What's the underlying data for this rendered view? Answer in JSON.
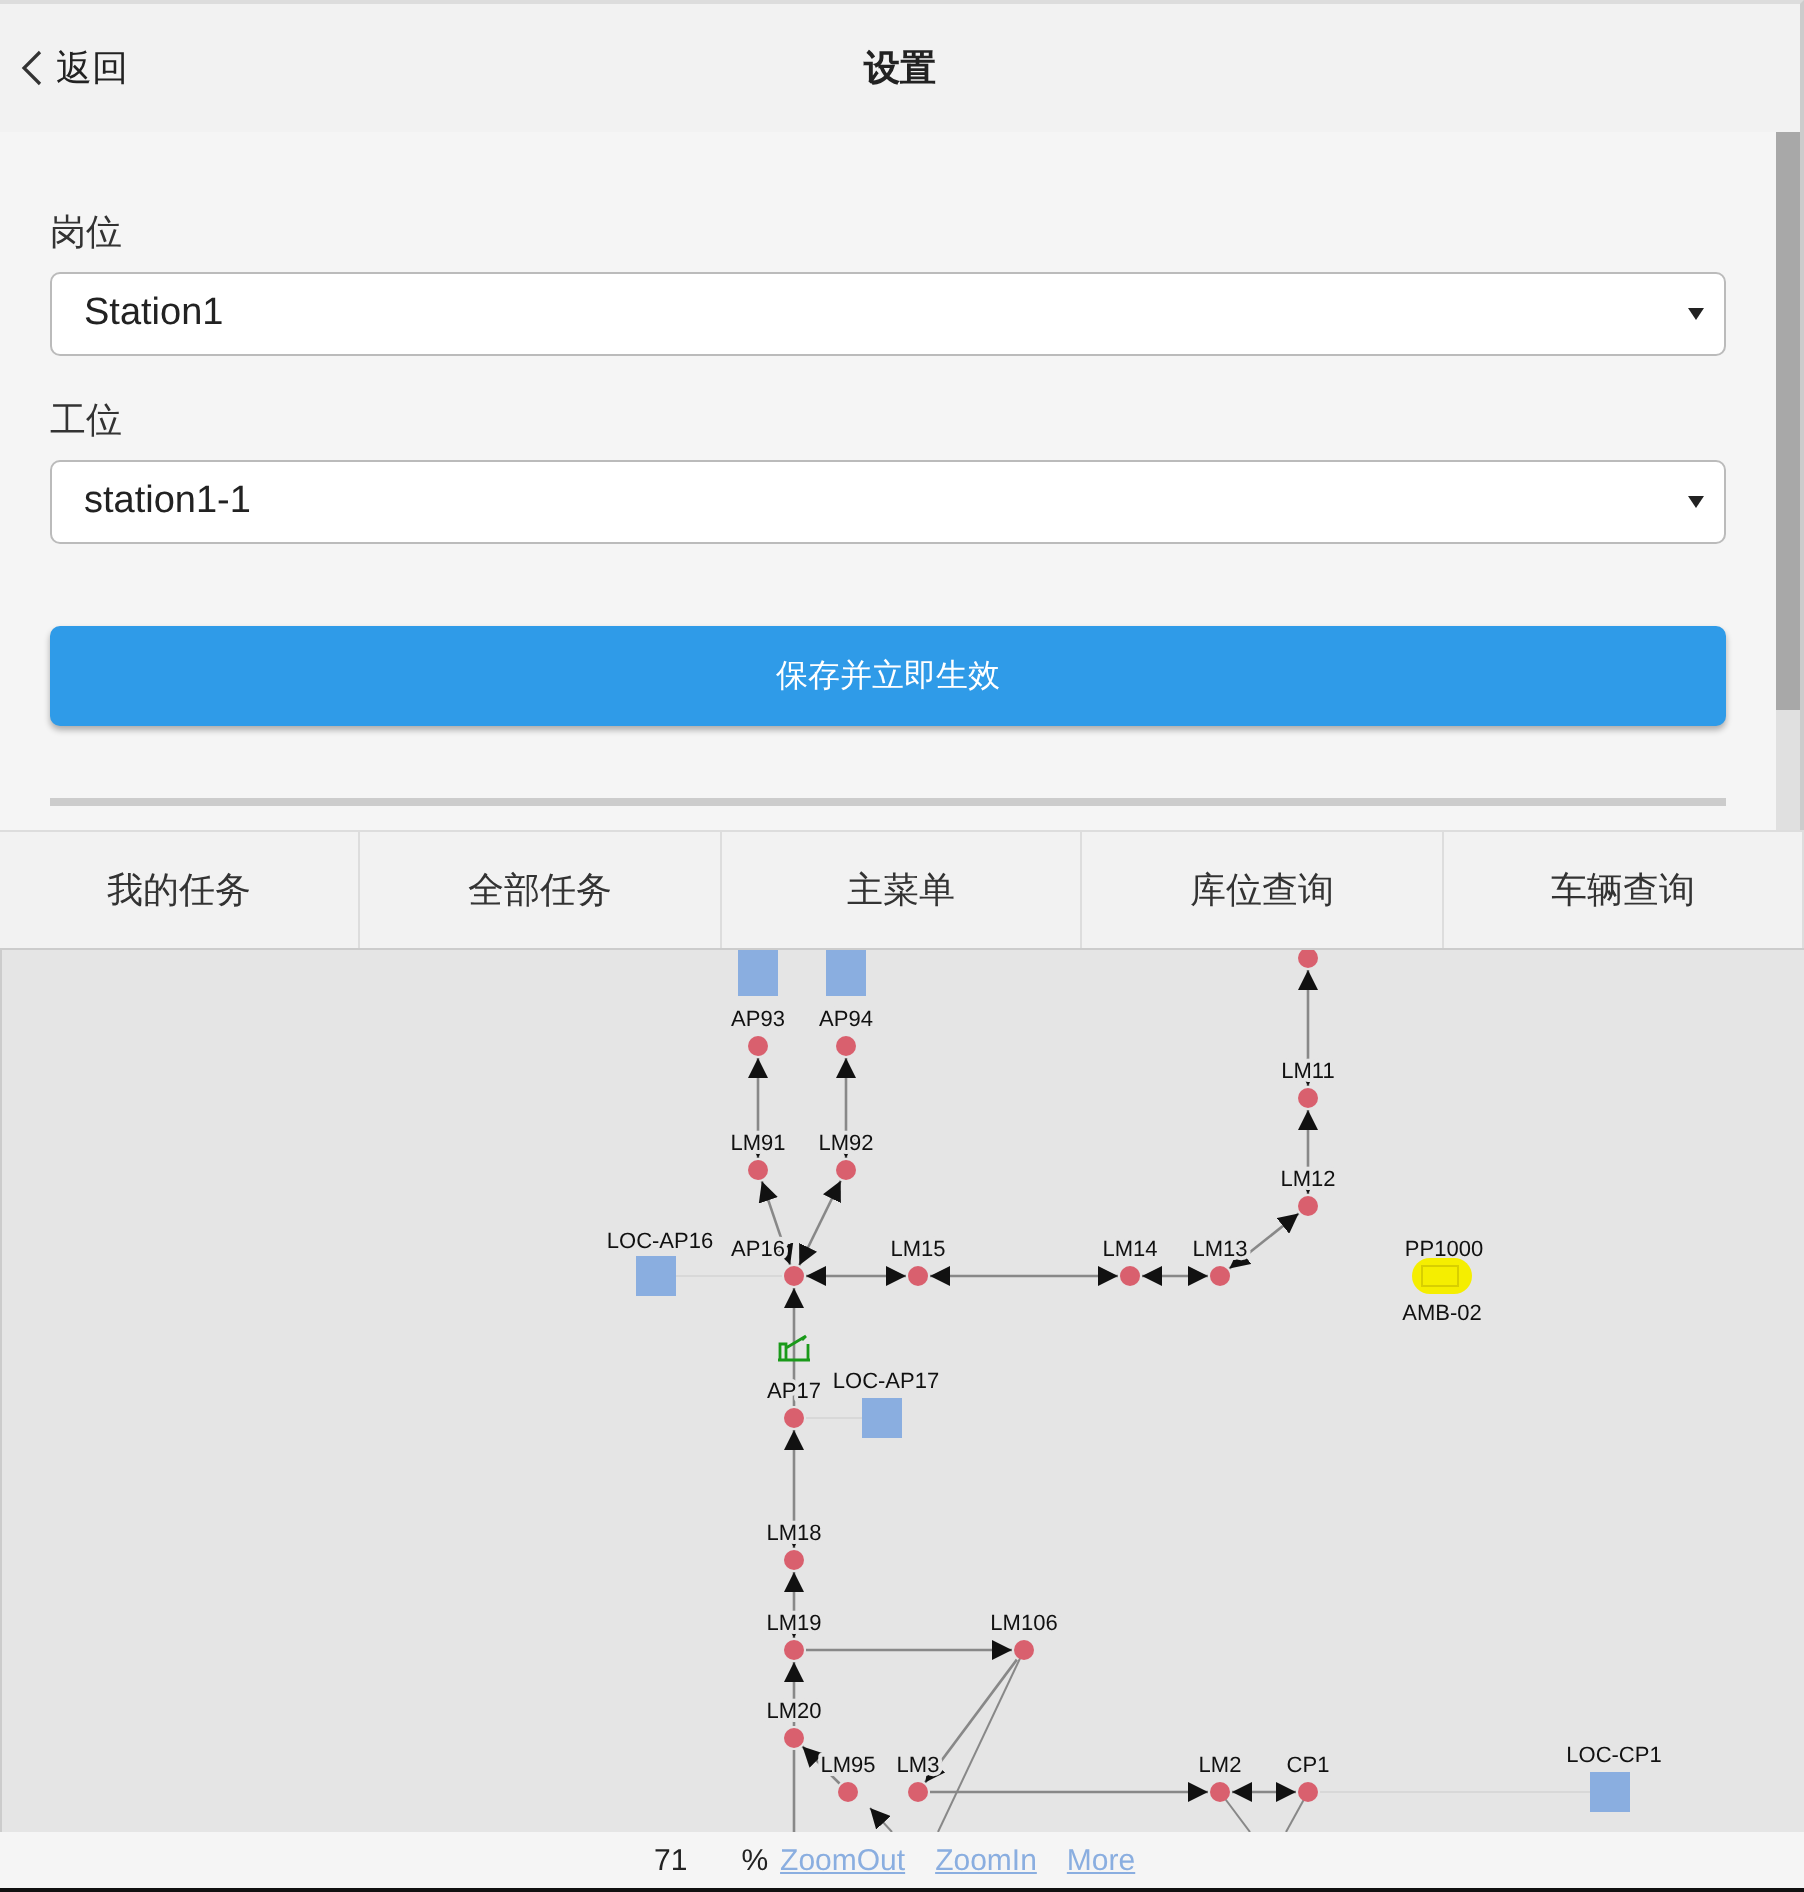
{
  "header": {
    "back": "返回",
    "title": "设置"
  },
  "form": {
    "fields": [
      {
        "label": "岗位",
        "value": "Station1"
      },
      {
        "label": "工位",
        "value": "station1-1"
      }
    ],
    "save_button": "保存并立即生效"
  },
  "tabs": [
    {
      "label": "我的任务"
    },
    {
      "label": "全部任务"
    },
    {
      "label": "主菜单"
    },
    {
      "label": "库位查询"
    },
    {
      "label": "车辆查询"
    }
  ],
  "map": {
    "nodes": [
      {
        "label": "AP93"
      },
      {
        "label": "AP94"
      },
      {
        "label": "LM91"
      },
      {
        "label": "LM92"
      },
      {
        "label": "AP16"
      },
      {
        "label": "LM15"
      },
      {
        "label": "LM14"
      },
      {
        "label": "LM13"
      },
      {
        "label": "LM11"
      },
      {
        "label": "LM12"
      },
      {
        "label": "AP17"
      },
      {
        "label": "LM18"
      },
      {
        "label": "LM19"
      },
      {
        "label": "LM106"
      },
      {
        "label": "LM20"
      },
      {
        "label": "LM95"
      },
      {
        "label": "LM3"
      },
      {
        "label": "LM2"
      },
      {
        "label": "CP1"
      }
    ],
    "locations": [
      {
        "label": "LOC-AP16"
      },
      {
        "label": "LOC-AP17"
      },
      {
        "label": "LOC-CP1"
      }
    ],
    "vehicle": {
      "code": "PP1000",
      "name": "AMB-02"
    }
  },
  "zoom_bar": {
    "value": "71",
    "unit": "%",
    "links": [
      "ZoomOut",
      "ZoomIn",
      "More"
    ]
  }
}
